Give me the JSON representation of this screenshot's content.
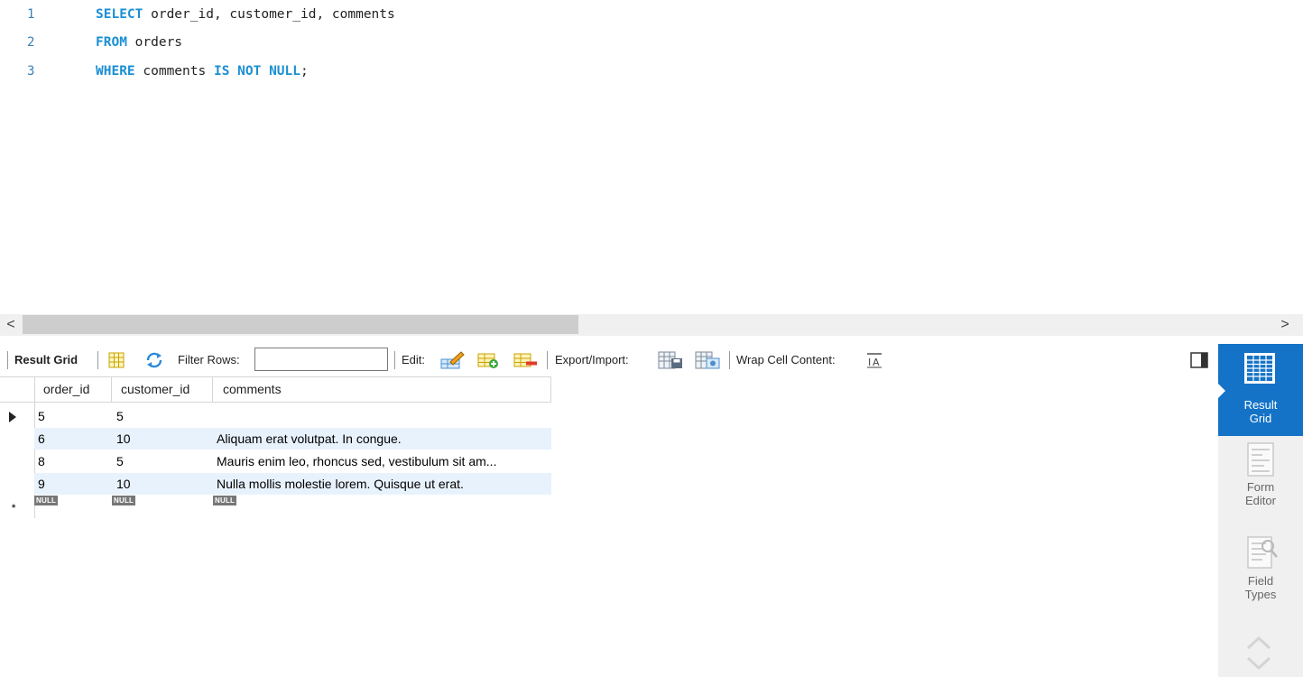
{
  "editor": {
    "lines": [
      {
        "no": "1",
        "kw1": "SELECT",
        "text1": " order_id, customer_id, comments",
        "kw2": "",
        "text2": ""
      },
      {
        "no": "2",
        "kw1": "FROM",
        "text1": " orders",
        "kw2": "",
        "text2": ""
      },
      {
        "no": "3",
        "kw1": "WHERE",
        "text1": " comments ",
        "kw2": "IS NOT NULL",
        "text2": ";"
      }
    ]
  },
  "scrollbar": {
    "left_arrow": "<",
    "right_arrow": ">"
  },
  "toolbar": {
    "result_grid_label": "Result Grid",
    "filter_rows_label": "Filter Rows:",
    "filter_value": "",
    "edit_label": "Edit:",
    "export_import_label": "Export/Import:",
    "wrap_label": "Wrap Cell Content:"
  },
  "grid": {
    "columns": [
      "order_id",
      "customer_id",
      "comments"
    ],
    "rows": [
      {
        "order_id": "5",
        "customer_id": "5",
        "comments": ""
      },
      {
        "order_id": "6",
        "customer_id": "10",
        "comments": "Aliquam erat volutpat. In congue."
      },
      {
        "order_id": "8",
        "customer_id": "5",
        "comments": "Mauris enim leo, rhoncus sed, vestibulum sit am..."
      },
      {
        "order_id": "9",
        "customer_id": "10",
        "comments": "Nulla mollis molestie lorem. Quisque ut erat."
      }
    ],
    "null_label": "NULL",
    "new_row_marker": "*"
  },
  "side_panel": {
    "result_grid": {
      "line1": "Result",
      "line2": "Grid"
    },
    "form_editor": {
      "line1": "Form",
      "line2": "Editor"
    },
    "field_types": {
      "line1": "Field",
      "line2": "Types"
    }
  },
  "colors": {
    "keyword": "#1b8fd3",
    "accent": "#1473c6",
    "alt_row": "#e8f2fd"
  }
}
